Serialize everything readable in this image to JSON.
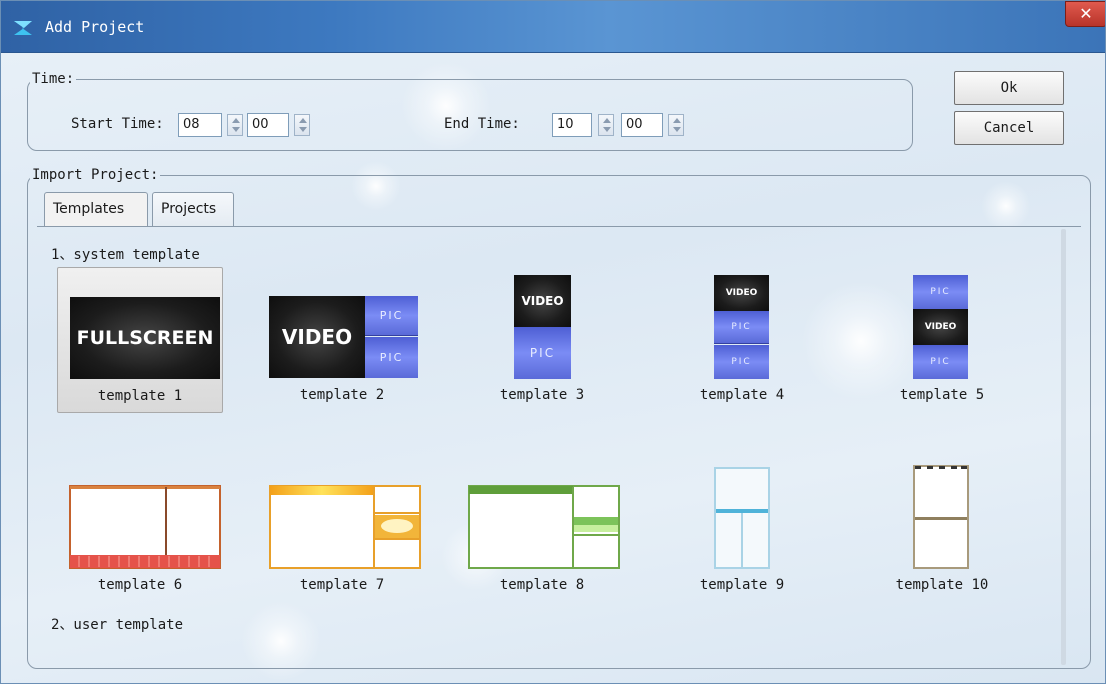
{
  "window": {
    "title": "Add Project",
    "close_glyph": "✕"
  },
  "time": {
    "legend": "Time:",
    "start_label": "Start Time:",
    "start_hour": "08",
    "start_minute": "00",
    "end_label": "End Time:",
    "end_hour": "10",
    "end_minute": "00"
  },
  "buttons": {
    "ok": "Ok",
    "cancel": "Cancel"
  },
  "import": {
    "legend": "Import Project:",
    "tabs": [
      {
        "label": "Templates",
        "active": true
      },
      {
        "label": "Projects",
        "active": false
      }
    ],
    "system_section": "1、system template",
    "user_section": "2、user template",
    "templates": [
      {
        "label": "template 1",
        "selected": true,
        "thumb_text": [
          "FULLSCREEN"
        ]
      },
      {
        "label": "template 2",
        "selected": false,
        "thumb_text": [
          "VIDEO",
          "PIC",
          "PIC"
        ]
      },
      {
        "label": "template 3",
        "selected": false,
        "thumb_text": [
          "VIDEO",
          "PIC"
        ]
      },
      {
        "label": "template 4",
        "selected": false,
        "thumb_text": [
          "VIDEO",
          "PIC",
          "PIC"
        ]
      },
      {
        "label": "template 5",
        "selected": false,
        "thumb_text": [
          "PIC",
          "VIDEO",
          "PIC"
        ]
      },
      {
        "label": "template 6",
        "selected": false,
        "thumb_text": []
      },
      {
        "label": "template 7",
        "selected": false,
        "thumb_text": []
      },
      {
        "label": "template 8",
        "selected": false,
        "thumb_text": []
      },
      {
        "label": "template 9",
        "selected": false,
        "thumb_text": []
      },
      {
        "label": "template 10",
        "selected": false,
        "thumb_text": []
      }
    ]
  },
  "colors": {
    "titlebar": "#3d79c0",
    "pic_blue": "#6a7bea",
    "video_dark": "#1c1c1c",
    "close_red": "#c9433a"
  }
}
